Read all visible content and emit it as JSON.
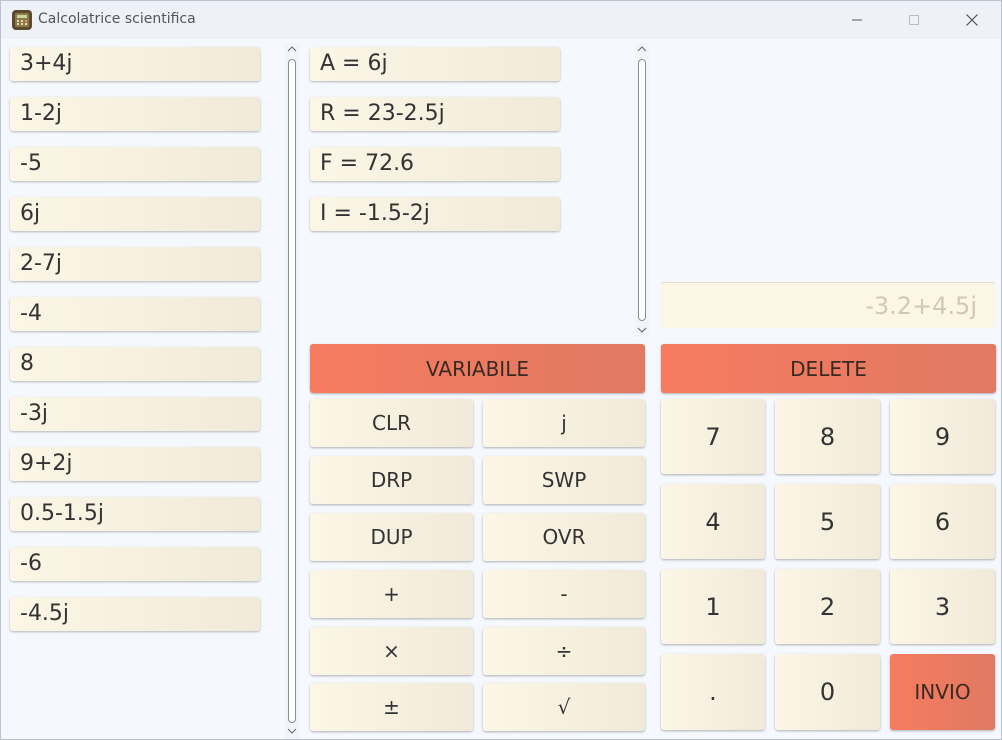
{
  "window": {
    "title": "Calcolatrice scientifica"
  },
  "stack": [
    "3+4j",
    "1-2j",
    "-5",
    "6j",
    "2-7j",
    "-4",
    "8",
    "-3j",
    "9+2j",
    "0.5-1.5j",
    "-6",
    "-4.5j"
  ],
  "variables": [
    "A = 6j",
    "R = 23-2.5j",
    "F = 72.6",
    "I = -1.5-2j"
  ],
  "display": {
    "value": "-3.2+4.5j"
  },
  "buttons": {
    "variabile": "VARIABILE",
    "delete": "DELETE",
    "ops": [
      "CLR",
      "j",
      "DRP",
      "SWP",
      "DUP",
      "OVR",
      "+",
      "-",
      "×",
      "÷",
      "±",
      "√"
    ],
    "keypad": [
      "7",
      "8",
      "9",
      "4",
      "5",
      "6",
      "1",
      "2",
      "3",
      ".",
      "0",
      "INVIO"
    ]
  },
  "colors": {
    "accent": "#f67b5f",
    "button_bg": "#f6efdf",
    "window_bg": "#f5f9ff"
  },
  "icons": {
    "app": "calculator-app-icon",
    "minimize": "minimize-icon",
    "maximize": "maximize-icon",
    "close": "close-icon"
  }
}
